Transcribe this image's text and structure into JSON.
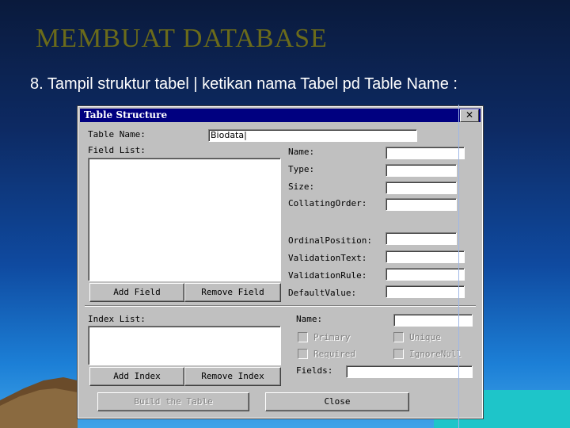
{
  "slide": {
    "title": "MEMBUAT  DATABASE",
    "subtitle": "8. Tampil struktur tabel | ketikan nama Tabel pd Table Name :"
  },
  "dialog": {
    "title": "Table Structure",
    "close_glyph": "✕",
    "table_name_label": "Table Name:",
    "table_name_value": "Biodata|",
    "field_list_label": "Field List:",
    "field_props": {
      "name_label": "Name:",
      "type_label": "Type:",
      "size_label": "Size:",
      "collating_order_label": "CollatingOrder:",
      "ordinal_position_label": "OrdinalPosition:",
      "validation_text_label": "ValidationText:",
      "validation_rule_label": "ValidationRule:",
      "default_value_label": "DefaultValue:"
    },
    "add_field_label": "Add Field",
    "remove_field_label": "Remove Field",
    "index_list_label": "Index List:",
    "index_props": {
      "name_label": "Name:",
      "primary_label": "Primary",
      "unique_label": "Unique",
      "required_label": "Required",
      "ignore_null_label": "IgnoreNull",
      "fields_label": "Fields:"
    },
    "add_index_label": "Add Index",
    "remove_index_label": "Remove Index",
    "build_table_label": "Build the Table",
    "close_label": "Close"
  }
}
